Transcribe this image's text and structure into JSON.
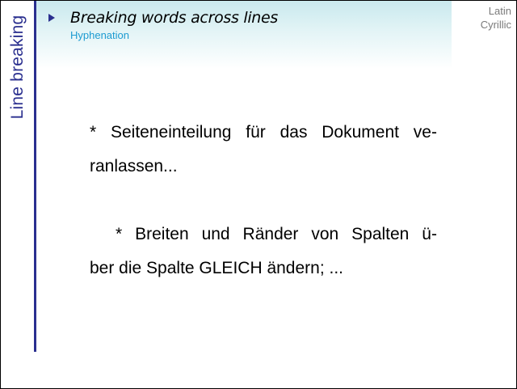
{
  "sidebar": {
    "section_title": "Line breaking"
  },
  "header": {
    "title": "Breaking words across lines",
    "subtitle": "Hyphenation",
    "bullet_icon": "play-triangle-icon"
  },
  "corner": {
    "script_1": "Latin",
    "script_2": "Cyrillic"
  },
  "content": {
    "paragraph_1": {
      "line_1_words": [
        "*",
        "Seiteneinteilung",
        "für",
        "das",
        "Dokument",
        "ve-"
      ],
      "line_2": "ranlassen..."
    },
    "paragraph_2": {
      "line_1_words": [
        "*",
        "Breiten",
        "und",
        "Ränder",
        "von",
        "Spalten",
        "ü-"
      ],
      "line_2": "ber die Spalte GLEICH ändern;  ..."
    }
  },
  "colors": {
    "accent": "#2a2f8f",
    "subtitle": "#1d9bd1",
    "corner_text": "#7a7a7a",
    "header_gradient_top": "#c9e9ee"
  }
}
